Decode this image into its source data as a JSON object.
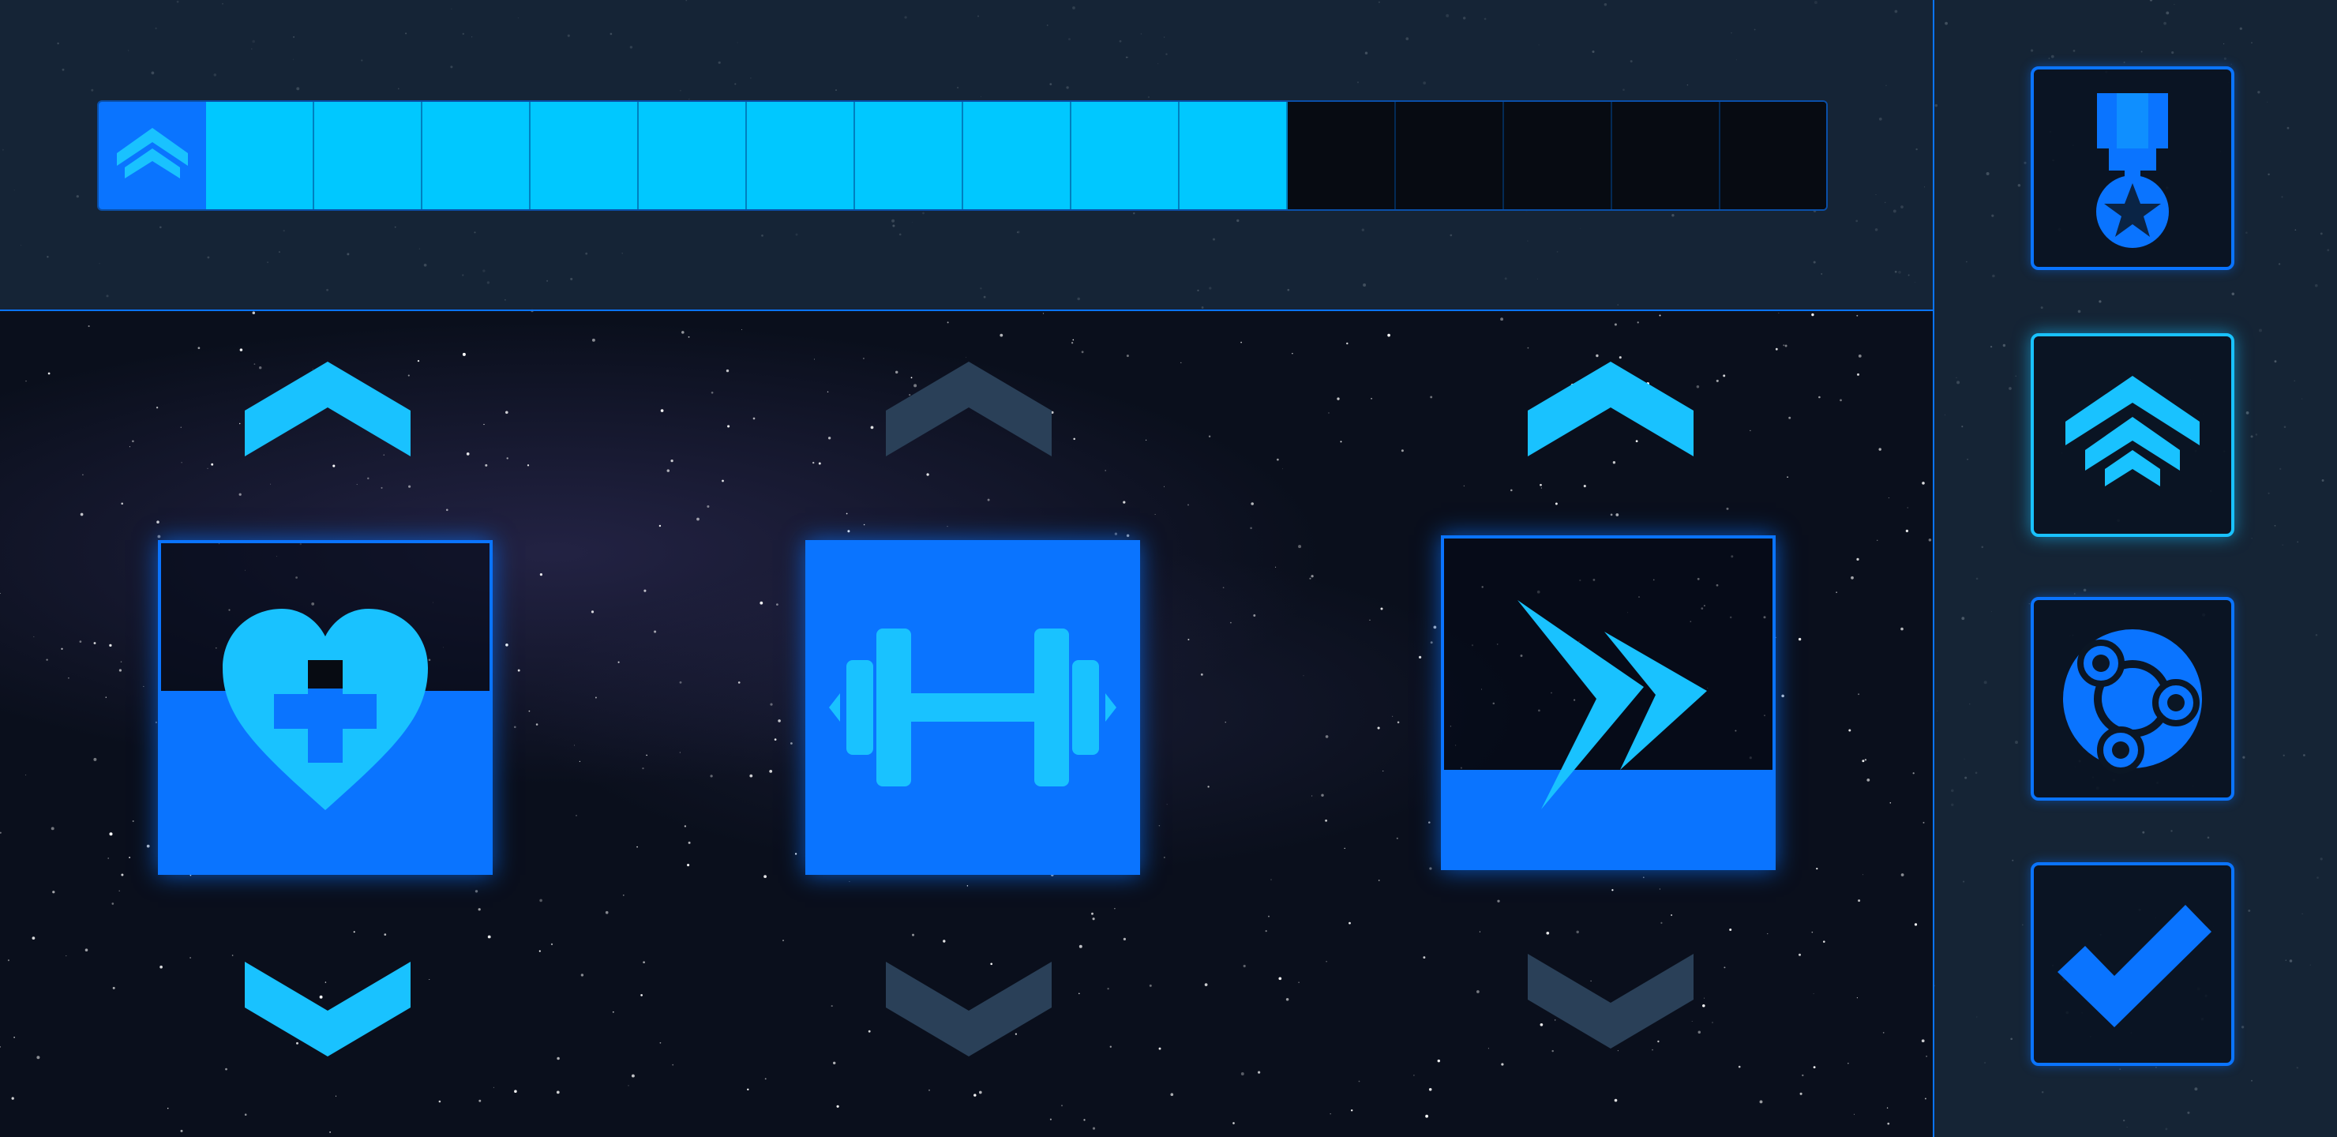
{
  "rank_progress": {
    "filled_segments": 10,
    "total_segments": 15,
    "colors": {
      "filled": "#00c8ff",
      "empty": "#070b12",
      "badge": "#0a74ff"
    }
  },
  "abilities": [
    {
      "name": "health",
      "icon": "heart-plus-icon",
      "fill_fraction": 0.55,
      "up_enabled": true,
      "down_enabled": true
    },
    {
      "name": "strength",
      "icon": "dumbbell-icon",
      "fill_fraction": 1.0,
      "up_enabled": false,
      "down_enabled": false
    },
    {
      "name": "speed",
      "icon": "double-chevron-right-icon",
      "fill_fraction": 0.3,
      "up_enabled": true,
      "down_enabled": false
    }
  ],
  "side_menu": [
    {
      "icon": "medal-icon",
      "active": false
    },
    {
      "icon": "rank-up-icon",
      "active": true
    },
    {
      "icon": "skill-tree-icon",
      "active": false
    },
    {
      "icon": "checkmark-icon",
      "active": false
    }
  ],
  "colors": {
    "accent": "#0a74ff",
    "highlight": "#19c2ff",
    "disabled": "#2a4058",
    "panel": "#182a3c"
  }
}
